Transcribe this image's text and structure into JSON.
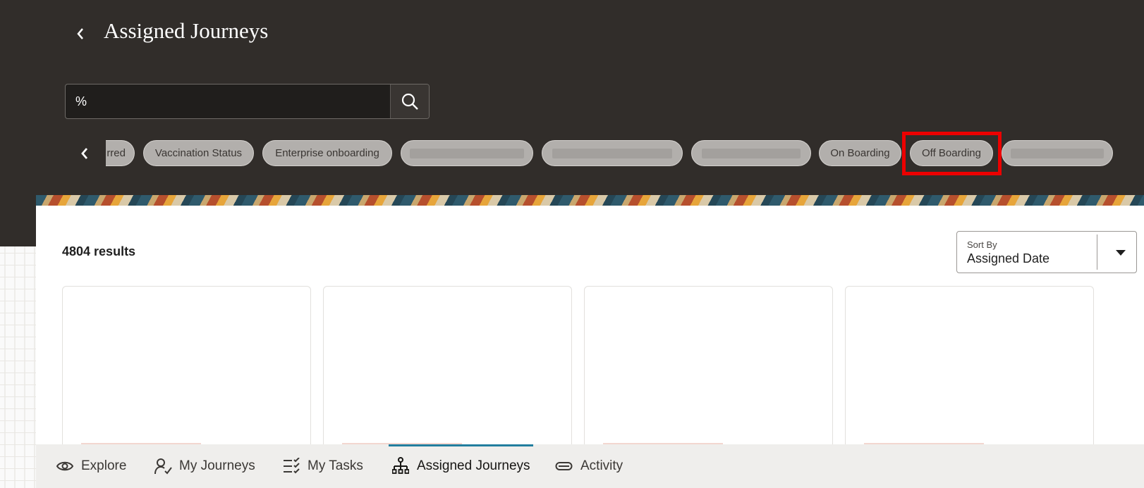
{
  "header": {
    "title": "Assigned Journeys",
    "back_icon": "chevron-left-icon"
  },
  "search": {
    "value": "%",
    "button_icon": "search-icon"
  },
  "chips": {
    "prev_icon": "chevron-left-icon",
    "items": [
      {
        "label": "rred",
        "partial": true
      },
      {
        "label": "Vaccination Status"
      },
      {
        "label": "Enterprise onboarding"
      },
      {
        "label": "",
        "redacted": true
      },
      {
        "label": "",
        "redacted": true
      },
      {
        "label": "",
        "redacted": true
      },
      {
        "label": "On Boarding"
      },
      {
        "label": "Off Boarding",
        "highlighted": true
      },
      {
        "label": "",
        "redacted": true
      }
    ]
  },
  "results": {
    "count_text": "4804 results"
  },
  "sort": {
    "label": "Sort By",
    "value": "Assigned Date"
  },
  "bottom_nav": {
    "items": [
      {
        "label": "Explore",
        "icon": "eye-icon"
      },
      {
        "label": "My Journeys",
        "icon": "person-check-icon"
      },
      {
        "label": "My Tasks",
        "icon": "checklist-icon"
      },
      {
        "label": "Assigned Journeys",
        "icon": "org-chart-icon",
        "active": true
      },
      {
        "label": "Activity",
        "icon": "pill-icon"
      }
    ]
  },
  "colors": {
    "header_bg": "#312d2a",
    "highlight": "#ec0000",
    "active_tab": "#227e9e"
  }
}
